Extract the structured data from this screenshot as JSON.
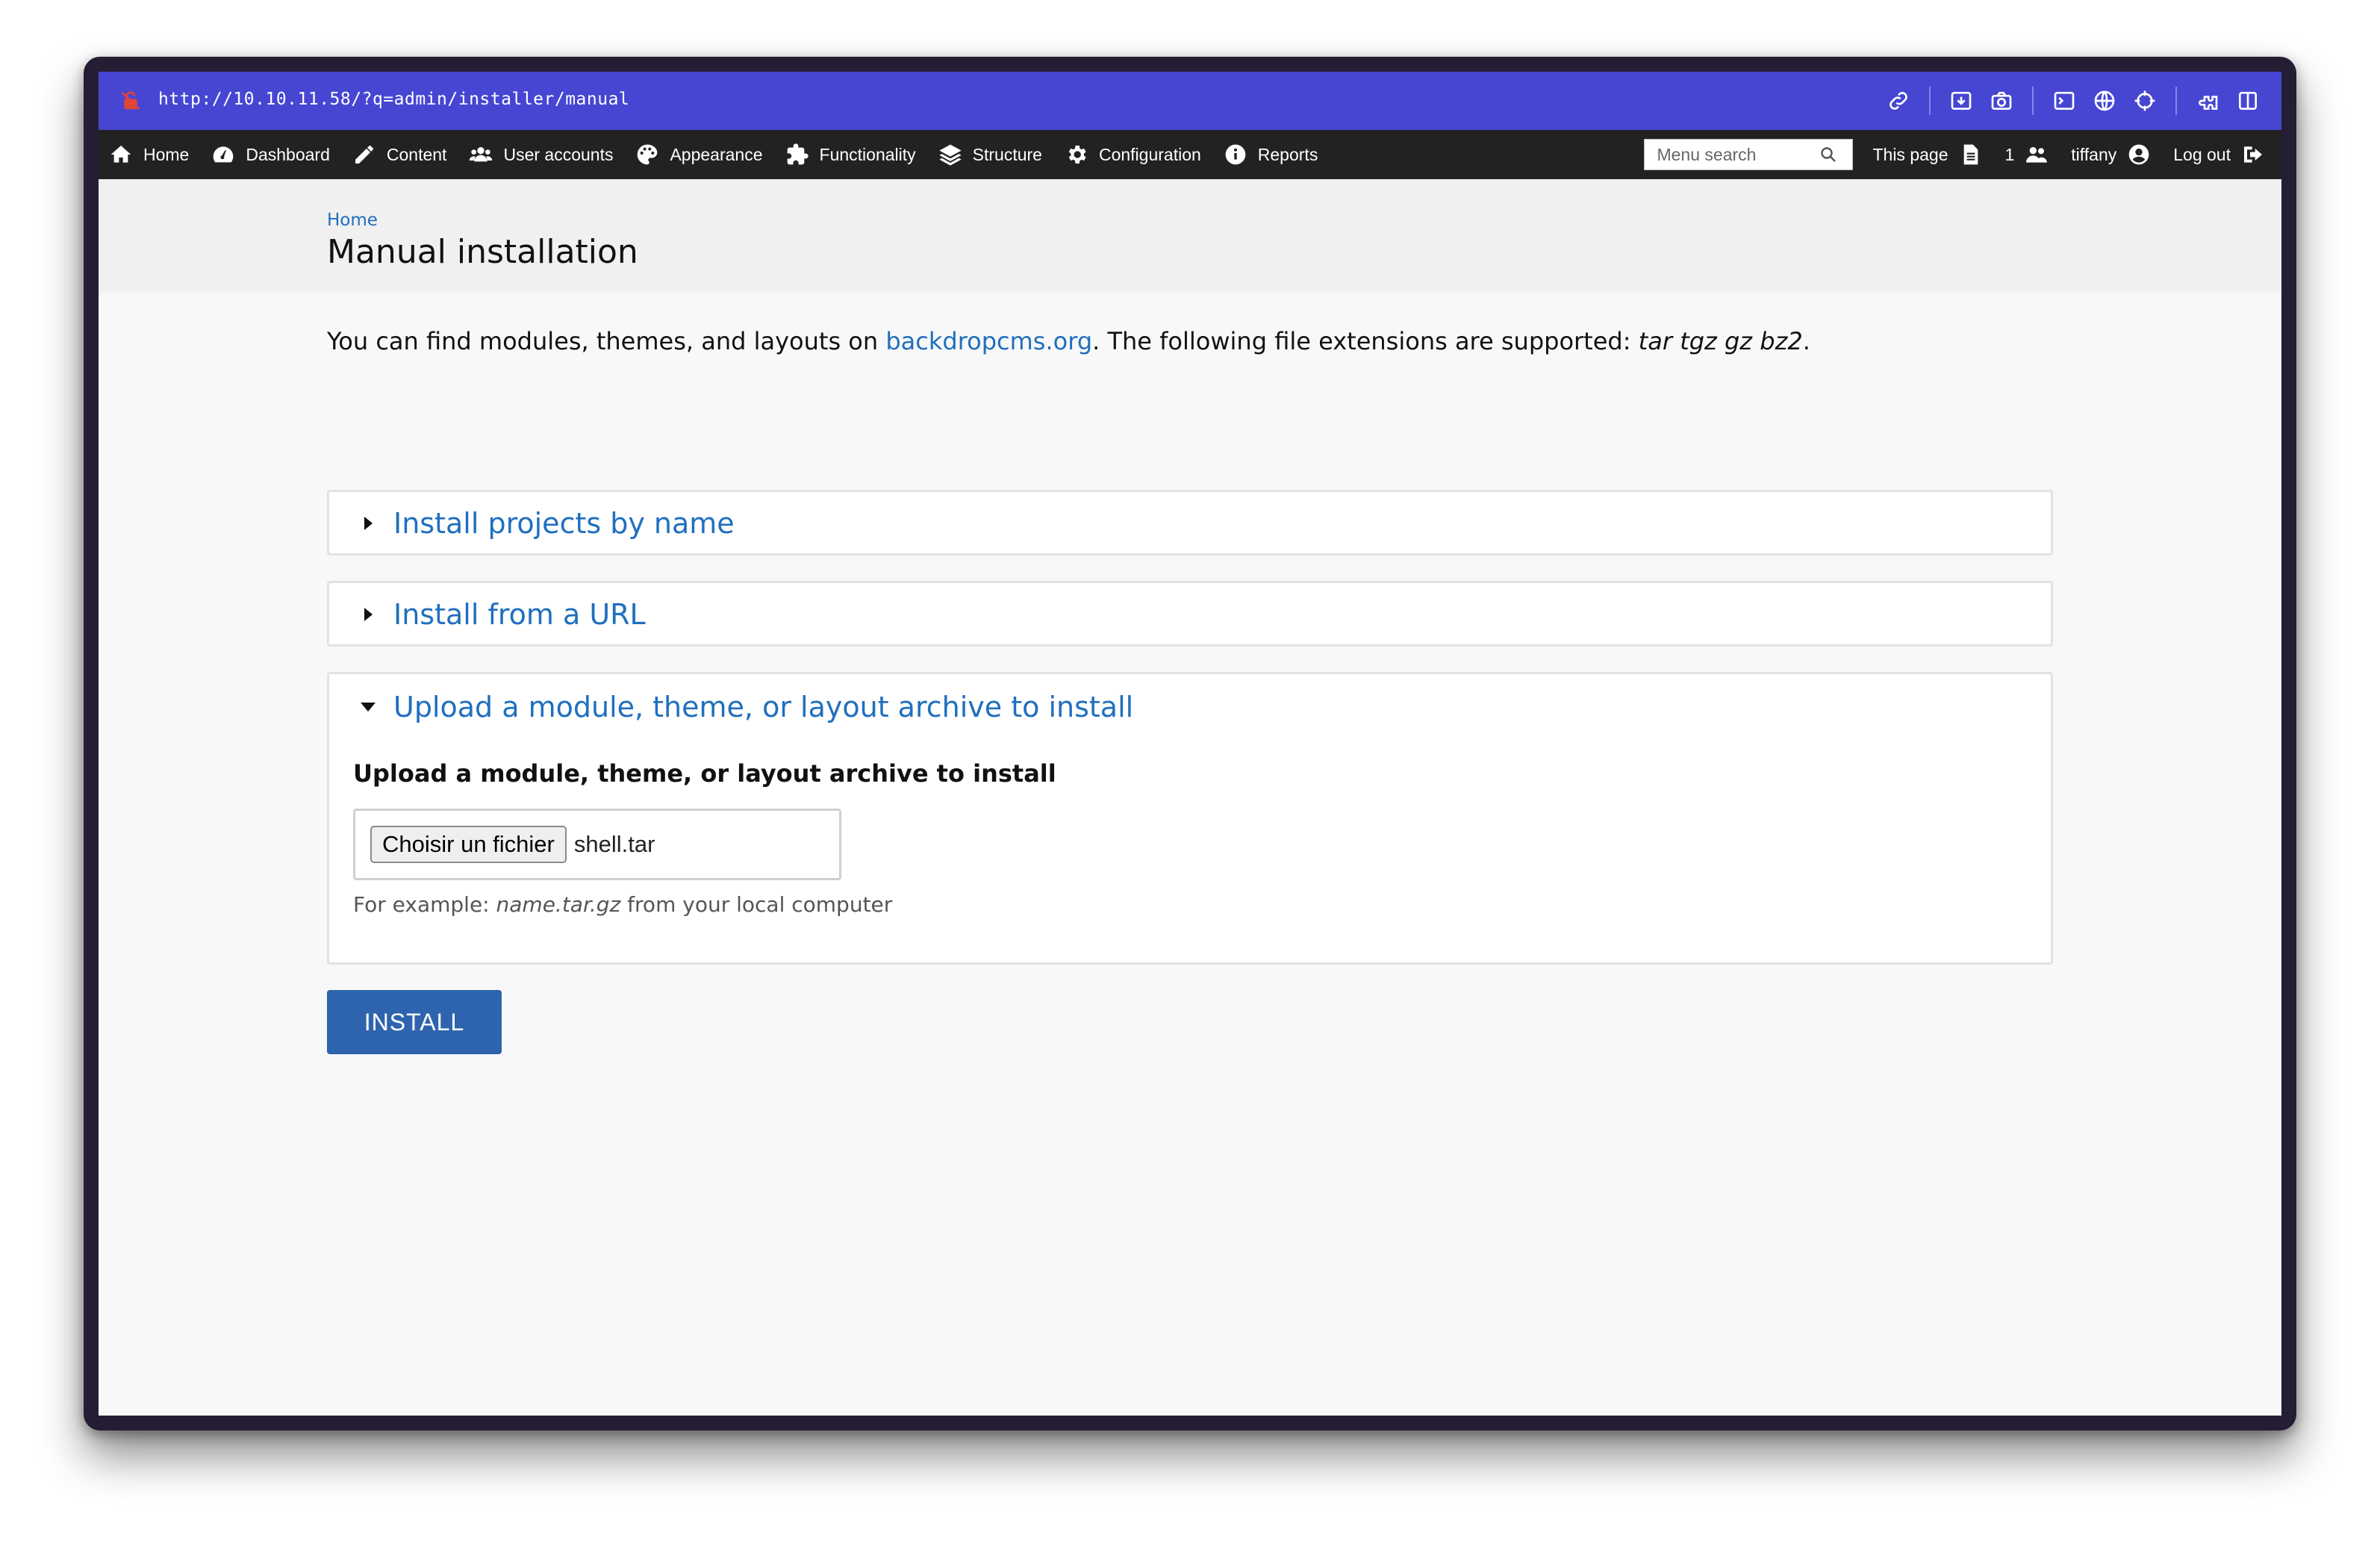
{
  "browser": {
    "url": "http://10.10.11.58/?q=admin/installer/manual",
    "tools": [
      "link-icon",
      "download-icon",
      "camera-icon",
      "terminal-icon",
      "globe-icon",
      "crosshair-icon",
      "extension-icon",
      "sidebar-icon"
    ]
  },
  "admin_bar": {
    "items": [
      {
        "label": "Home",
        "icon": "home-icon"
      },
      {
        "label": "Dashboard",
        "icon": "dashboard-icon"
      },
      {
        "label": "Content",
        "icon": "pencil-icon"
      },
      {
        "label": "User accounts",
        "icon": "users-icon"
      },
      {
        "label": "Appearance",
        "icon": "palette-icon"
      },
      {
        "label": "Functionality",
        "icon": "puzzle-icon"
      },
      {
        "label": "Structure",
        "icon": "layers-icon"
      },
      {
        "label": "Configuration",
        "icon": "gear-icon"
      },
      {
        "label": "Reports",
        "icon": "info-icon"
      }
    ],
    "search_placeholder": "Menu search",
    "this_page": "This page",
    "user_count": "1",
    "username": "tiffany",
    "logout": "Log out"
  },
  "header": {
    "breadcrumb": "Home",
    "title": "Manual installation"
  },
  "intro": {
    "before_link": "You can find modules, themes, and layouts on ",
    "link": "backdropcms.org",
    "after_link": ". The following file extensions are supported: ",
    "extensions": "tar tgz gz bz2",
    "end": "."
  },
  "fieldsets": {
    "by_name": "Install projects by name",
    "from_url": "Install from a URL",
    "upload": "Upload a module, theme, or layout archive to install"
  },
  "upload": {
    "label": "Upload a module, theme, or layout archive to install",
    "choose_button": "Choisir un fichier",
    "file_name": "shell.tar",
    "help_prefix": "For example: ",
    "help_example": "name.tar.gz",
    "help_suffix": " from your local computer"
  },
  "actions": {
    "install": "INSTALL"
  },
  "colors": {
    "url_bar": "#4646d3",
    "admin_bar": "#222222",
    "link": "#1f6fbf",
    "primary_button": "#2e64ad"
  }
}
